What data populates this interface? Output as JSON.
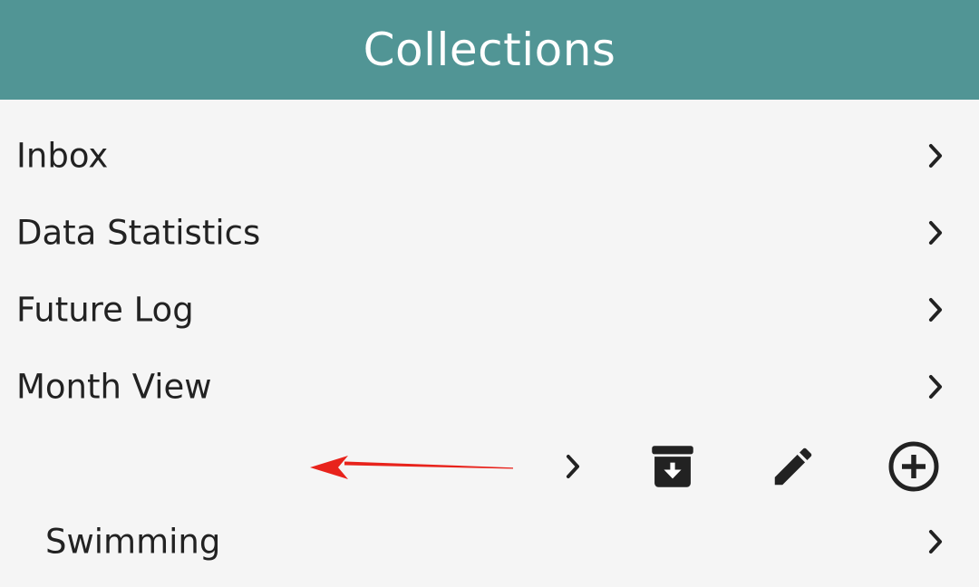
{
  "header": {
    "title": "Collections",
    "background": "#519595"
  },
  "items": [
    {
      "label": "Inbox",
      "icon": "chevron-right-icon"
    },
    {
      "label": "Data Statistics",
      "icon": "chevron-right-icon"
    },
    {
      "label": "Future Log",
      "icon": "chevron-right-icon"
    },
    {
      "label": "Month View",
      "icon": "chevron-right-icon"
    }
  ],
  "collection_toolbar": {
    "icons": [
      "chevron-right-icon",
      "archive-icon",
      "edit-icon",
      "add-circle-icon"
    ],
    "annotation_color": "#e8231c"
  },
  "sub_items": [
    {
      "label": "Swimming",
      "icon": "chevron-right-icon"
    }
  ]
}
